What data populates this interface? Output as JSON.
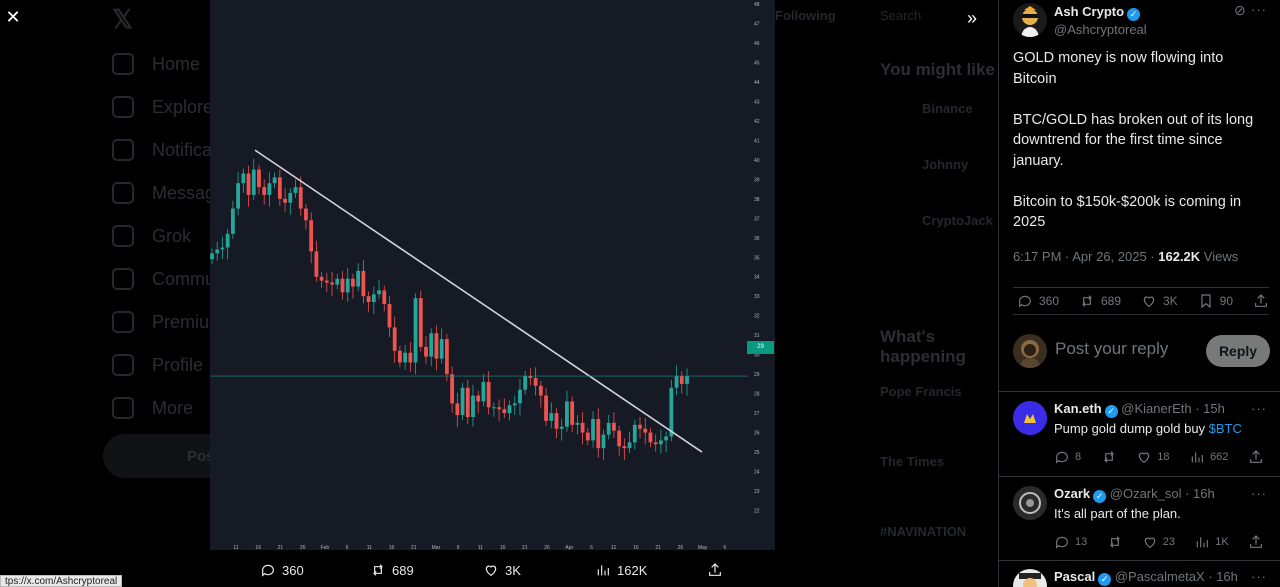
{
  "background": {
    "nav": [
      "Home",
      "Explore",
      "Notifications",
      "Messages",
      "Grok",
      "Communities",
      "Premium",
      "Profile",
      "More"
    ],
    "post_button": "Post",
    "search_placeholder": "Search",
    "you_might_like": "You might like",
    "suggestions": [
      "Binance",
      "Johnny",
      "CryptoJack"
    ],
    "whats_happening": "What's happening",
    "trends": [
      "Pope Francis",
      "The Times",
      "#NAVINATION"
    ],
    "following_label": "Following"
  },
  "media": {
    "close_label": "✕",
    "expand_label": "»",
    "status_url": "tps://x.com/Ashcryptoreal"
  },
  "chart_data": {
    "type": "candlestick",
    "title": "",
    "xlabel": "",
    "ylabel": "",
    "ylim": [
      21,
      48
    ],
    "y_ticks": [
      22,
      23,
      24,
      25,
      26,
      27,
      28,
      29,
      30,
      31,
      32,
      33,
      34,
      35,
      36,
      37,
      38,
      39,
      40,
      41,
      42,
      43,
      44,
      45,
      46,
      47,
      48
    ],
    "x_tick_labels": [
      "11",
      "16",
      "21",
      "26",
      "Feb",
      "6",
      "11",
      "16",
      "21",
      "Mar",
      "6",
      "11",
      "16",
      "21",
      "26",
      "Apr",
      "6",
      "11",
      "16",
      "21",
      "26",
      "May",
      "6"
    ],
    "current_price_label": "29",
    "trendline": {
      "from": [
        0,
        40.5
      ],
      "to": [
        1,
        25.0
      ]
    },
    "horizontal_level": 28.9,
    "closes": [
      35.2,
      35.4,
      35.5,
      36.2,
      37.5,
      38.8,
      39.3,
      38.2,
      39.5,
      38.6,
      38.2,
      38.8,
      39.1,
      38.0,
      37.8,
      38.3,
      38.6,
      37.5,
      36.9,
      35.3,
      34.0,
      33.8,
      33.7,
      33.6,
      33.9,
      33.2,
      33.9,
      33.5,
      34.3,
      33.0,
      32.7,
      33.1,
      33.3,
      32.6,
      31.4,
      30.2,
      29.6,
      30.1,
      29.6,
      32.9,
      30.4,
      29.9,
      31.1,
      29.8,
      30.8,
      29.0,
      27.5,
      26.9,
      28.3,
      26.8,
      27.9,
      27.6,
      28.6,
      27.3,
      27.3,
      27.2,
      27.0,
      27.4,
      27.5,
      28.2,
      28.9,
      28.8,
      28.4,
      27.9,
      26.6,
      27.0,
      26.2,
      26.3,
      27.6,
      26.4,
      26.5,
      26.0,
      25.6,
      26.7,
      25.2,
      25.9,
      26.5,
      26.1,
      25.3,
      25.2,
      25.5,
      26.4,
      26.2,
      26.0,
      25.5,
      25.4,
      25.6,
      25.8,
      28.3,
      28.9,
      28.5,
      28.9
    ],
    "series_colors": {
      "up": "#26a69a",
      "down": "#ef5350"
    }
  },
  "media_bar": {
    "replies": "360",
    "reposts": "689",
    "likes": "3K",
    "views": "162K"
  },
  "post": {
    "author_name": "Ash Crypto",
    "author_handle": "@Ashcryptoreal",
    "text": "GOLD money is now flowing into Bitcoin\n\nBTC/GOLD has broken out of its long downtrend for the first time since january.\n\nBitcoin to $150k-$200k is coming in 2025",
    "time": "6:17 PM · Apr 26, 2025 · ",
    "views_count": "162.2K",
    "views_label": " Views",
    "replies": "360",
    "reposts": "689",
    "likes": "3K",
    "bookmarks": "90",
    "reply_placeholder": "Post your reply",
    "reply_button": "Reply"
  },
  "replies": [
    {
      "name": "Kan.eth",
      "handle": "@KianerEth",
      "time": "· 15h",
      "text_prefix": "Pump gold dump gold buy ",
      "text_link": "$BTC",
      "replies": "8",
      "reposts": "",
      "likes": "18",
      "views": "662"
    },
    {
      "name": "Ozark",
      "handle": "@Ozark_sol",
      "time": "· 16h",
      "text_prefix": "It's all part of the plan.",
      "text_link": "",
      "replies": "13",
      "reposts": "",
      "likes": "23",
      "views": "1K"
    },
    {
      "name": "Pascal",
      "handle": "@PascalmetaX",
      "time": "· 16h",
      "text_prefix": "",
      "text_link": "",
      "replies": "",
      "reposts": "",
      "likes": "",
      "views": ""
    }
  ],
  "colors": {
    "accent": "#1d9bf0",
    "chart_bg": "#161a25",
    "trendline": "#d1d4dc"
  }
}
